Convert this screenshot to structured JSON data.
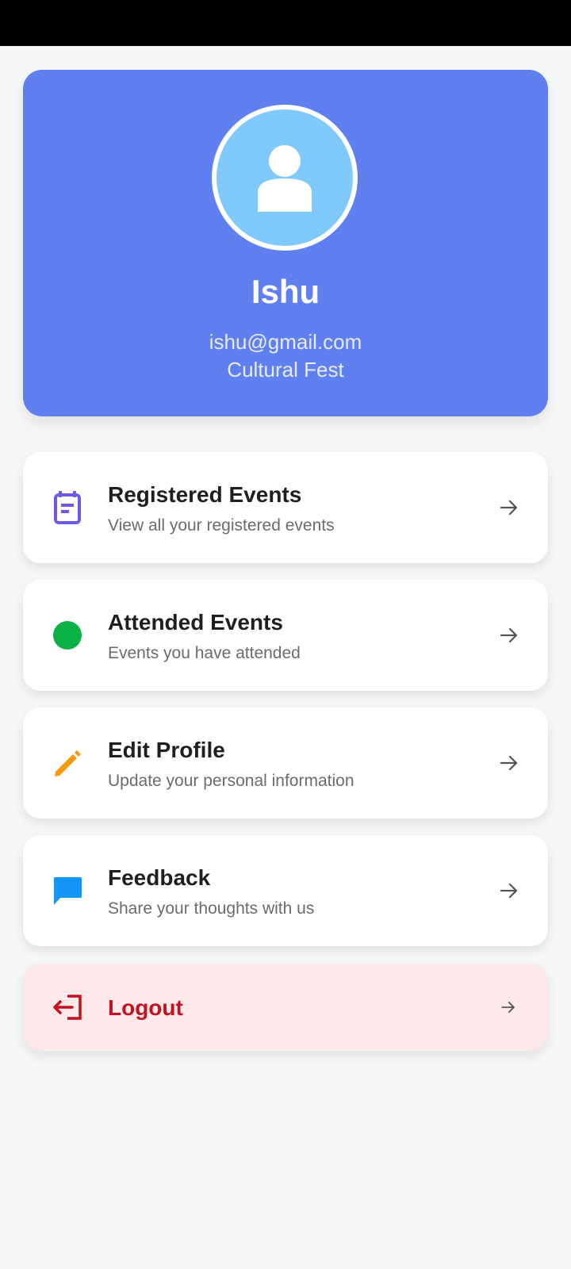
{
  "profile": {
    "name": "Ishu",
    "email": "ishu@gmail.com",
    "event": "Cultural Fest",
    "avatar_icon": "person-icon"
  },
  "menu": {
    "items": [
      {
        "title": "Registered Events",
        "subtitle": "View all your registered events",
        "icon": "calendar-icon",
        "color": "#6b5be6"
      },
      {
        "title": "Attended Events",
        "subtitle": "Events you have attended",
        "icon": "green-dot-icon",
        "color": "#0bb347"
      },
      {
        "title": "Edit Profile",
        "subtitle": "Update your personal information",
        "icon": "pencil-icon",
        "color": "#f59a0c"
      },
      {
        "title": "Feedback",
        "subtitle": "Share your thoughts with us",
        "icon": "chat-bubble-icon",
        "color": "#1496f7"
      }
    ],
    "logout": {
      "label": "Logout",
      "icon": "logout-icon",
      "color": "#c4111f"
    }
  },
  "colors": {
    "header_bg": "#6080f2",
    "avatar_bg": "#80cafb",
    "page_bg": "#f6f7f9",
    "logout_bg": "#fde8ea"
  }
}
